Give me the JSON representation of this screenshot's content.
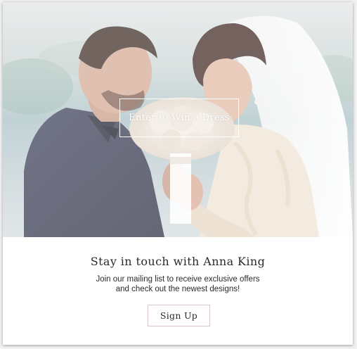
{
  "hero": {
    "image_alt": "Bride and groom holding a bouquet",
    "cta_label": "Enter to Win a Dress"
  },
  "content": {
    "title": "Stay in touch with Anna King",
    "subtitle_line1": "Join our mailing list to receive exclusive offers",
    "subtitle_line2": "and check out the newest designs!",
    "signup_label": "Sign Up"
  },
  "colors": {
    "card_background": "#ffffff",
    "text": "#2a2a2a",
    "button_border": "#d9c6c6"
  }
}
